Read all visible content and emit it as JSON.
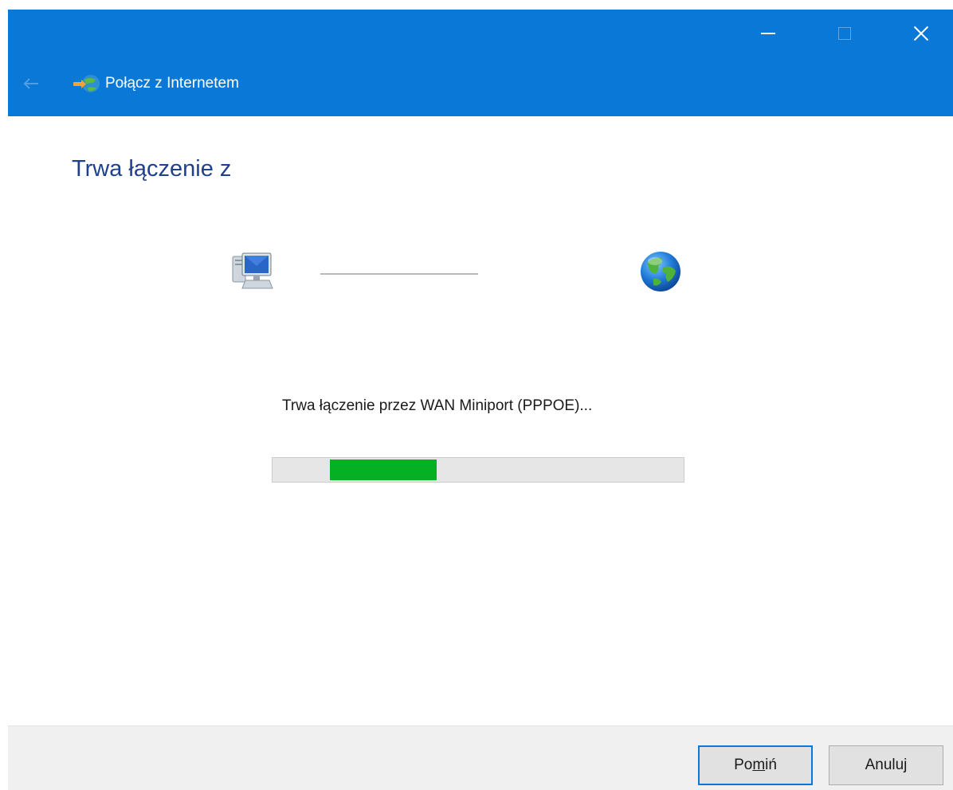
{
  "titlebar": {
    "accent_color": "#0a78d7",
    "minimize_icon": "minimize-icon",
    "maximize_icon": "maximize-icon",
    "close_icon": "close-icon",
    "back_icon": "back-arrow-icon",
    "wizard_icon": "network-connection-icon",
    "title": "Połącz z Internetem"
  },
  "main": {
    "heading": "Trwa łączenie z",
    "computer_icon": "computer-icon",
    "globe_icon": "globe-icon",
    "status": "Trwa łączenie przez WAN Miniport (PPPOE)...",
    "progress": {
      "start": 0.14,
      "value": 0.26,
      "fill_color": "#06b025"
    }
  },
  "footer": {
    "skip_label": "Pomiń",
    "cancel_label": "Anuluj"
  }
}
